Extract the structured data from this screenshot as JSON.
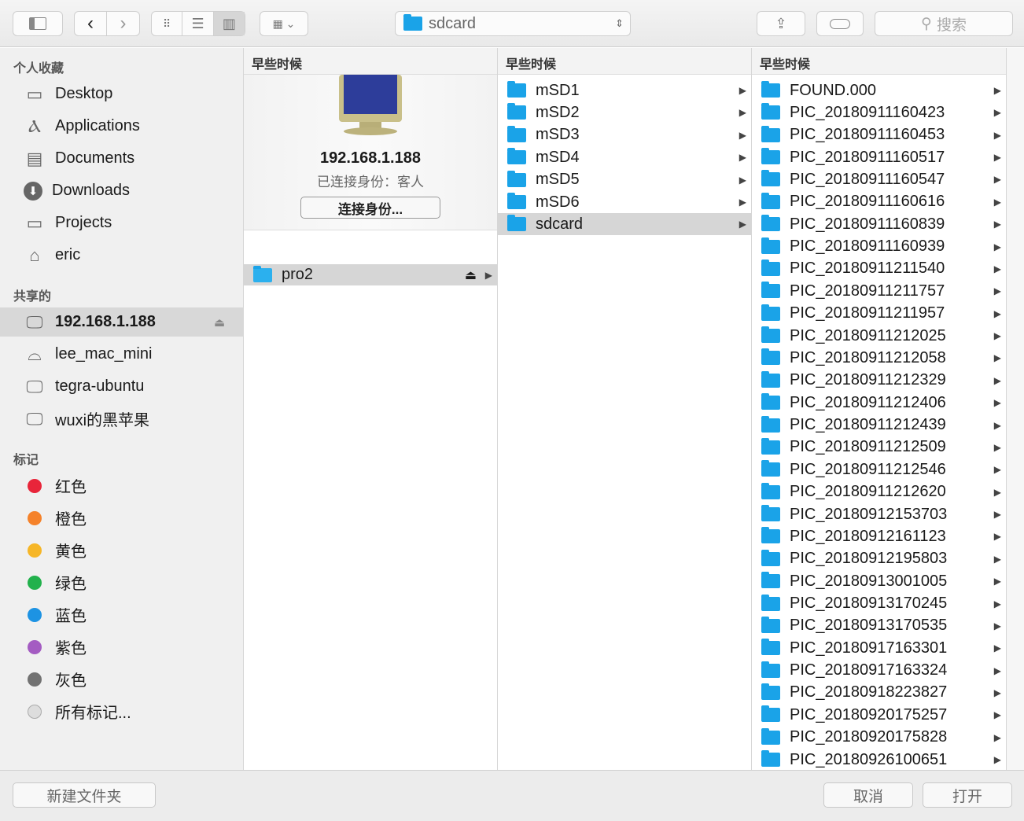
{
  "toolbar": {
    "path": "sdcard",
    "search_placeholder": "搜索"
  },
  "sidebar": {
    "favorites_title": "个人收藏",
    "favorites": [
      {
        "label": "Desktop",
        "icon": "desktop-icon"
      },
      {
        "label": "Applications",
        "icon": "applications-icon"
      },
      {
        "label": "Documents",
        "icon": "documents-icon"
      },
      {
        "label": "Downloads",
        "icon": "downloads-icon"
      },
      {
        "label": "Projects",
        "icon": "folder-icon"
      },
      {
        "label": "eric",
        "icon": "home-icon"
      }
    ],
    "shared_title": "共享的",
    "shared": [
      {
        "label": "192.168.1.188",
        "icon": "monitor-icon",
        "selected": true
      },
      {
        "label": "lee_mac_mini",
        "icon": "mac-mini-icon"
      },
      {
        "label": "tegra-ubuntu",
        "icon": "monitor-icon"
      },
      {
        "label": "wuxi的黑苹果",
        "icon": "imac-icon"
      }
    ],
    "tags_title": "标记",
    "tags": [
      {
        "label": "红色",
        "color": "#e8253a"
      },
      {
        "label": "橙色",
        "color": "#f5822a"
      },
      {
        "label": "黄色",
        "color": "#f6b627"
      },
      {
        "label": "绿色",
        "color": "#22b14c"
      },
      {
        "label": "蓝色",
        "color": "#1d93e3"
      },
      {
        "label": "紫色",
        "color": "#a45cc2"
      },
      {
        "label": "灰色",
        "color": "#727272"
      },
      {
        "label": "所有标记...",
        "color": "#dddddd"
      }
    ]
  },
  "column1": {
    "header": "早些时候",
    "host": "192.168.1.188",
    "status": "已连接身份：客人",
    "connect_button": "连接身份...",
    "items": [
      "pro2"
    ]
  },
  "column2": {
    "header": "早些时候",
    "items": [
      "mSD1",
      "mSD2",
      "mSD3",
      "mSD4",
      "mSD5",
      "mSD6",
      "sdcard"
    ],
    "selected": "sdcard"
  },
  "column3": {
    "header": "早些时候",
    "items": [
      "FOUND.000",
      "PIC_20180911160423",
      "PIC_20180911160453",
      "PIC_20180911160517",
      "PIC_20180911160547",
      "PIC_20180911160616",
      "PIC_20180911160839",
      "PIC_20180911160939",
      "PIC_20180911211540",
      "PIC_20180911211757",
      "PIC_20180911211957",
      "PIC_20180911212025",
      "PIC_20180911212058",
      "PIC_20180911212329",
      "PIC_20180911212406",
      "PIC_20180911212439",
      "PIC_20180911212509",
      "PIC_20180911212546",
      "PIC_20180911212620",
      "PIC_20180912153703",
      "PIC_20180912161123",
      "PIC_20180912195803",
      "PIC_20180913001005",
      "PIC_20180913170245",
      "PIC_20180913170535",
      "PIC_20180917163301",
      "PIC_20180917163324",
      "PIC_20180918223827",
      "PIC_20180920175257",
      "PIC_20180920175828",
      "PIC_20180926100651"
    ]
  },
  "footer": {
    "new_folder": "新建文件夹",
    "cancel": "取消",
    "open": "打开"
  }
}
